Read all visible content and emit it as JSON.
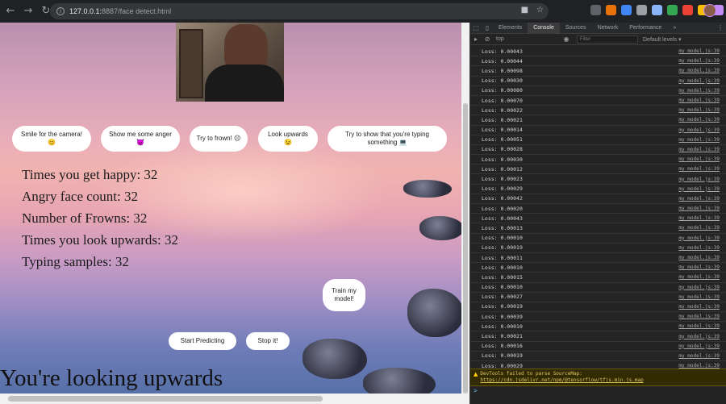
{
  "browser": {
    "url_host": "127.0.0.1:",
    "url_path": "8887/face detect.html",
    "back_icon": "arrow-left",
    "forward_icon": "arrow-right",
    "reload_icon": "reload"
  },
  "page": {
    "buttons": [
      {
        "label": "Smile for the camera!😊"
      },
      {
        "label": "Show me some anger 😈"
      },
      {
        "label": "Try to frown! ☹"
      },
      {
        "label": "Look upwards😉"
      },
      {
        "label": "Try to show that you're typing something 💻"
      }
    ],
    "stats": [
      "Times you get happy: 32",
      "Angry face count: 32",
      "Number of Frowns: 32",
      "Times you look upwards: 32",
      "Typing samples: 32"
    ],
    "train_button": "Train my model!",
    "start_button": "Start Predicting",
    "stop_button": "Stop it!",
    "status": "You're looking upwards"
  },
  "devtools": {
    "tabs": [
      "Elements",
      "Console",
      "Sources",
      "Network",
      "Performance",
      "»"
    ],
    "active_tab": "Console",
    "context": "top",
    "filter_placeholder": "Filter",
    "levels": "Default levels ▾",
    "logs": [
      {
        "msg": "Loss: 0.00043",
        "src": "my_model.js:39"
      },
      {
        "msg": "Loss: 0.00044",
        "src": "my_model.js:39"
      },
      {
        "msg": "Loss: 0.00098",
        "src": "my_model.js:39"
      },
      {
        "msg": "Loss: 0.00030",
        "src": "my_model.js:39"
      },
      {
        "msg": "Loss: 0.00080",
        "src": "my_model.js:39"
      },
      {
        "msg": "Loss: 0.00070",
        "src": "my_model.js:39"
      },
      {
        "msg": "Loss: 0.00022",
        "src": "my_model.js:39"
      },
      {
        "msg": "Loss: 0.00021",
        "src": "my_model.js:39"
      },
      {
        "msg": "Loss: 0.00014",
        "src": "my_model.js:39"
      },
      {
        "msg": "Loss: 0.00051",
        "src": "my_model.js:39"
      },
      {
        "msg": "Loss: 0.00028",
        "src": "my_model.js:39"
      },
      {
        "msg": "Loss: 0.00030",
        "src": "my_model.js:39"
      },
      {
        "msg": "Loss: 0.00012",
        "src": "my_model.js:39"
      },
      {
        "msg": "Loss: 0.00023",
        "src": "my_model.js:39"
      },
      {
        "msg": "Loss: 0.00029",
        "src": "my_model.js:39"
      },
      {
        "msg": "Loss: 0.00042",
        "src": "my_model.js:39"
      },
      {
        "msg": "Loss: 0.00020",
        "src": "my_model.js:39"
      },
      {
        "msg": "Loss: 0.00043",
        "src": "my_model.js:39"
      },
      {
        "msg": "Loss: 0.00013",
        "src": "my_model.js:39"
      },
      {
        "msg": "Loss: 0.00010",
        "src": "my_model.js:39"
      },
      {
        "msg": "Loss: 0.00019",
        "src": "my_model.js:39"
      },
      {
        "msg": "Loss: 0.00011",
        "src": "my_model.js:39"
      },
      {
        "msg": "Loss: 0.00010",
        "src": "my_model.js:39"
      },
      {
        "msg": "Loss: 0.00015",
        "src": "my_model.js:39"
      },
      {
        "msg": "Loss: 0.00010",
        "src": "my_model.js:39"
      },
      {
        "msg": "Loss: 0.00027",
        "src": "my_model.js:39"
      },
      {
        "msg": "Loss: 0.00019",
        "src": "my_model.js:39"
      },
      {
        "msg": "Loss: 0.00039",
        "src": "my_model.js:39"
      },
      {
        "msg": "Loss: 0.00010",
        "src": "my_model.js:39"
      },
      {
        "msg": "Loss: 0.00021",
        "src": "my_model.js:39"
      },
      {
        "msg": "Loss: 0.00016",
        "src": "my_model.js:39"
      },
      {
        "msg": "Loss: 0.00019",
        "src": "my_model.js:39"
      },
      {
        "msg": "Loss: 0.00029",
        "src": "my_model.js:39"
      }
    ],
    "warning_text": "DevTools failed to parse SourceMap: ",
    "warning_link": "https://cdn.jsdelivr.net/npm/@tensorflow/tfjs.min.js.map",
    "prompt": ">"
  }
}
